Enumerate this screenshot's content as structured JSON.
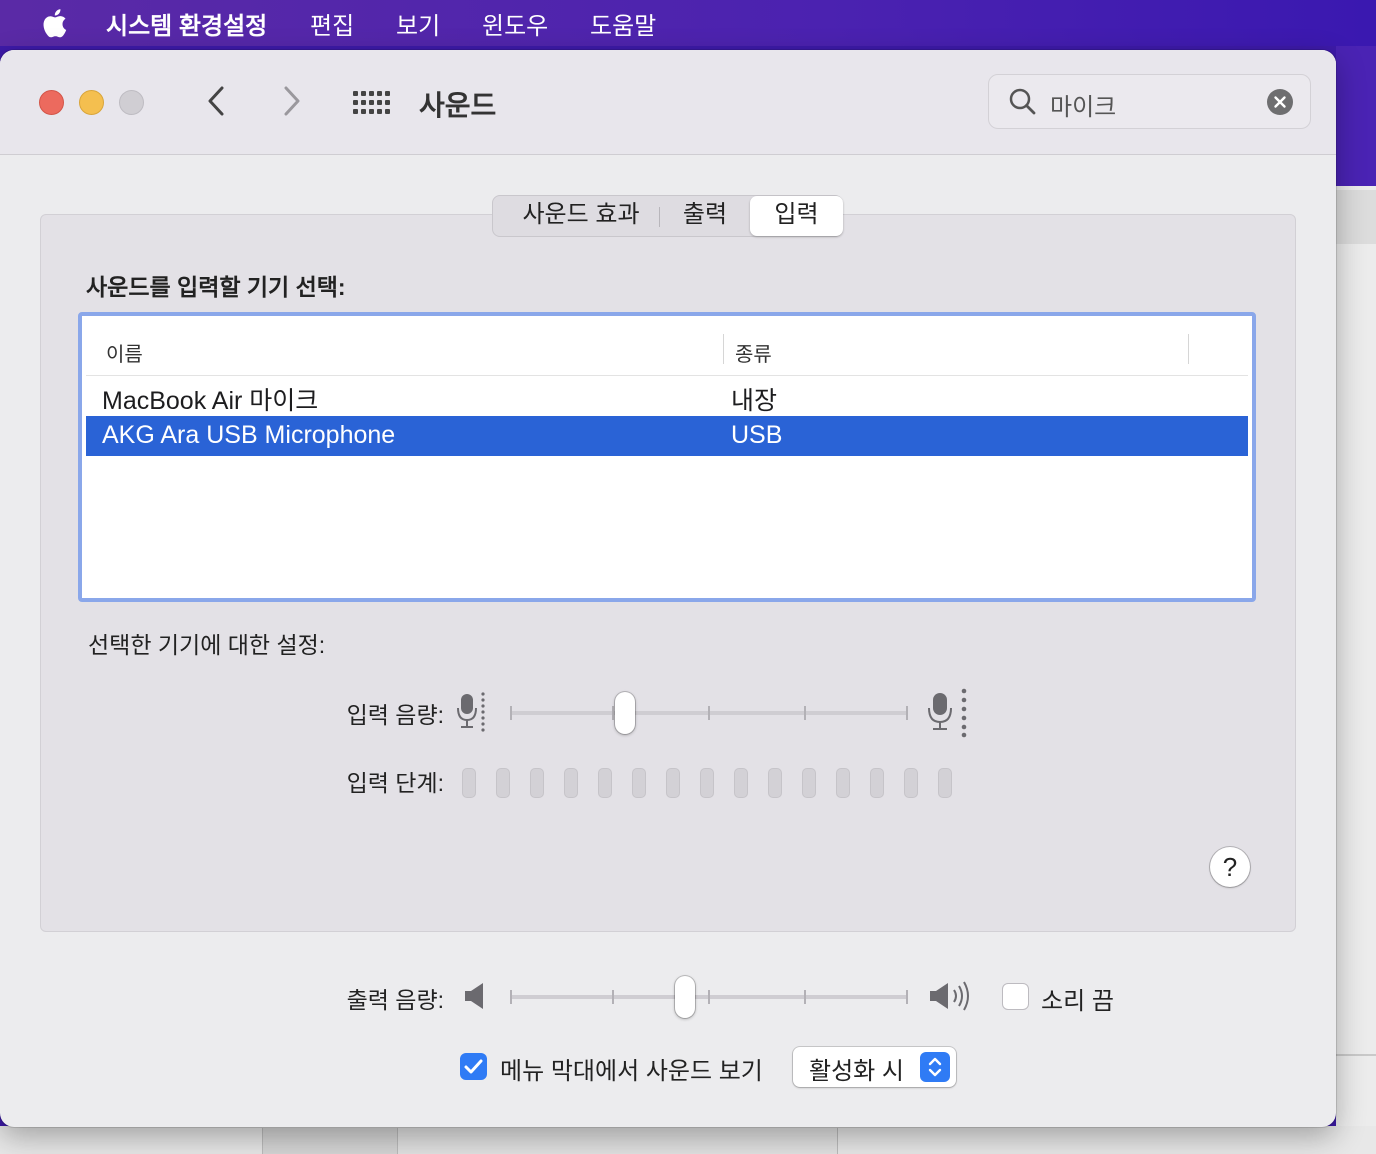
{
  "menubar": {
    "app_name": "시스템 환경설정",
    "items": [
      "편집",
      "보기",
      "윈도우",
      "도움말"
    ]
  },
  "window": {
    "title": "사운드",
    "search": {
      "value": "마이크"
    }
  },
  "tabs": [
    "사운드 효과",
    "출력",
    "입력"
  ],
  "selected_tab": "입력",
  "input": {
    "section_label": "사운드를 입력할 기기 선택:",
    "columns": [
      "이름",
      "종류"
    ],
    "devices": [
      {
        "name": "MacBook Air 마이크",
        "type": "내장",
        "selected": false
      },
      {
        "name": "AKG Ara USB Microphone",
        "type": "USB",
        "selected": true
      }
    ],
    "settings_label": "선택한 기기에 대한 설정:",
    "volume_label": "입력 음량:",
    "volume_fraction": 0.29,
    "level_label": "입력 단계:",
    "level_bars": 15,
    "level_active": 0
  },
  "help": {
    "label": "?"
  },
  "output": {
    "volume_label": "출력 음량:",
    "volume_fraction": 0.44,
    "mute_label": "소리 끔",
    "mute_checked": false
  },
  "menu_bar_option": {
    "label": "메뉴 막대에서 사운드 보기",
    "checked": true,
    "popup_value": "활성화 시"
  },
  "colors": {
    "selection": "#2a63d6",
    "accent": "#2f7bf5",
    "focus_ring": "#8aa7ea"
  }
}
